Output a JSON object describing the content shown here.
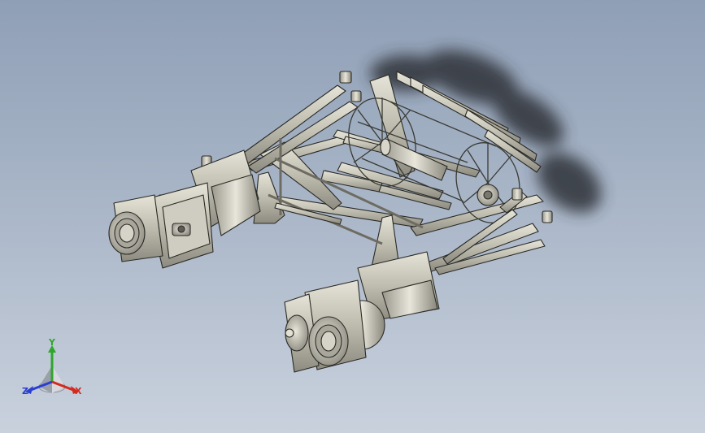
{
  "viewport": {
    "background_top": "#8f9fb6",
    "background_bottom": "#c9d1dd"
  },
  "model": {
    "name": "paddle-wheel-steam-engine-assembly",
    "part_color": "#c8c6b8",
    "shadow_color": "#2d3138"
  },
  "triad": {
    "x_label": "X",
    "y_label": "Y",
    "z_label": "Z",
    "x_color": "#d42a1c",
    "y_color": "#2fa62b",
    "z_color": "#2a3fd1"
  }
}
